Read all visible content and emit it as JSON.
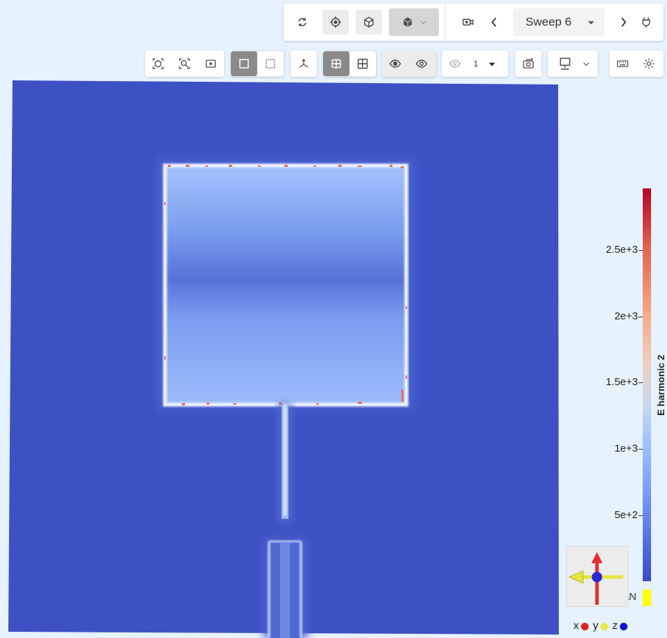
{
  "top_toolbar": {
    "sweep": {
      "selected": "Sweep 6"
    },
    "icons": [
      "sync-icon",
      "crosshair-icon",
      "cube-outline-icon",
      "cube-solid-icon",
      "camera-video-icon",
      "chevron-left-icon",
      "chevron-right-icon",
      "plug-icon"
    ]
  },
  "view_toolbar": {
    "layer_count": "1",
    "icons": [
      "fit-object-icon",
      "zoom-region-icon",
      "fit-box-icon",
      "select-box-icon",
      "select-dotted-icon",
      "axes-icon",
      "split-view-icon",
      "grid-view-icon",
      "eye-hide-icon",
      "eye-show-icon",
      "eye-layer-icon",
      "screenshot-icon",
      "monitor-icon",
      "keyboard-icon",
      "settings-icon"
    ]
  },
  "colorbar": {
    "title": "E harmonic 2",
    "ticks": [
      {
        "label": "2.5e+3",
        "value": 2500
      },
      {
        "label": "2e+3",
        "value": 2000
      },
      {
        "label": "1.5e+3",
        "value": 1500
      },
      {
        "label": "1e+3",
        "value": 1000
      },
      {
        "label": "5e+2",
        "value": 500
      }
    ],
    "min": 0,
    "max": 2850,
    "nan_label": "NaN",
    "nan_color": "#ffff00",
    "colormap": [
      "#3b4cc0",
      "#9abbff",
      "#dddddd",
      "#f7a889",
      "#b40426"
    ]
  },
  "axes_legend": {
    "x_label": "x",
    "x_color": "#e02020",
    "y_label": "y",
    "y_color": "#e8e84a",
    "z_label": "z",
    "z_color": "#1010d0"
  }
}
